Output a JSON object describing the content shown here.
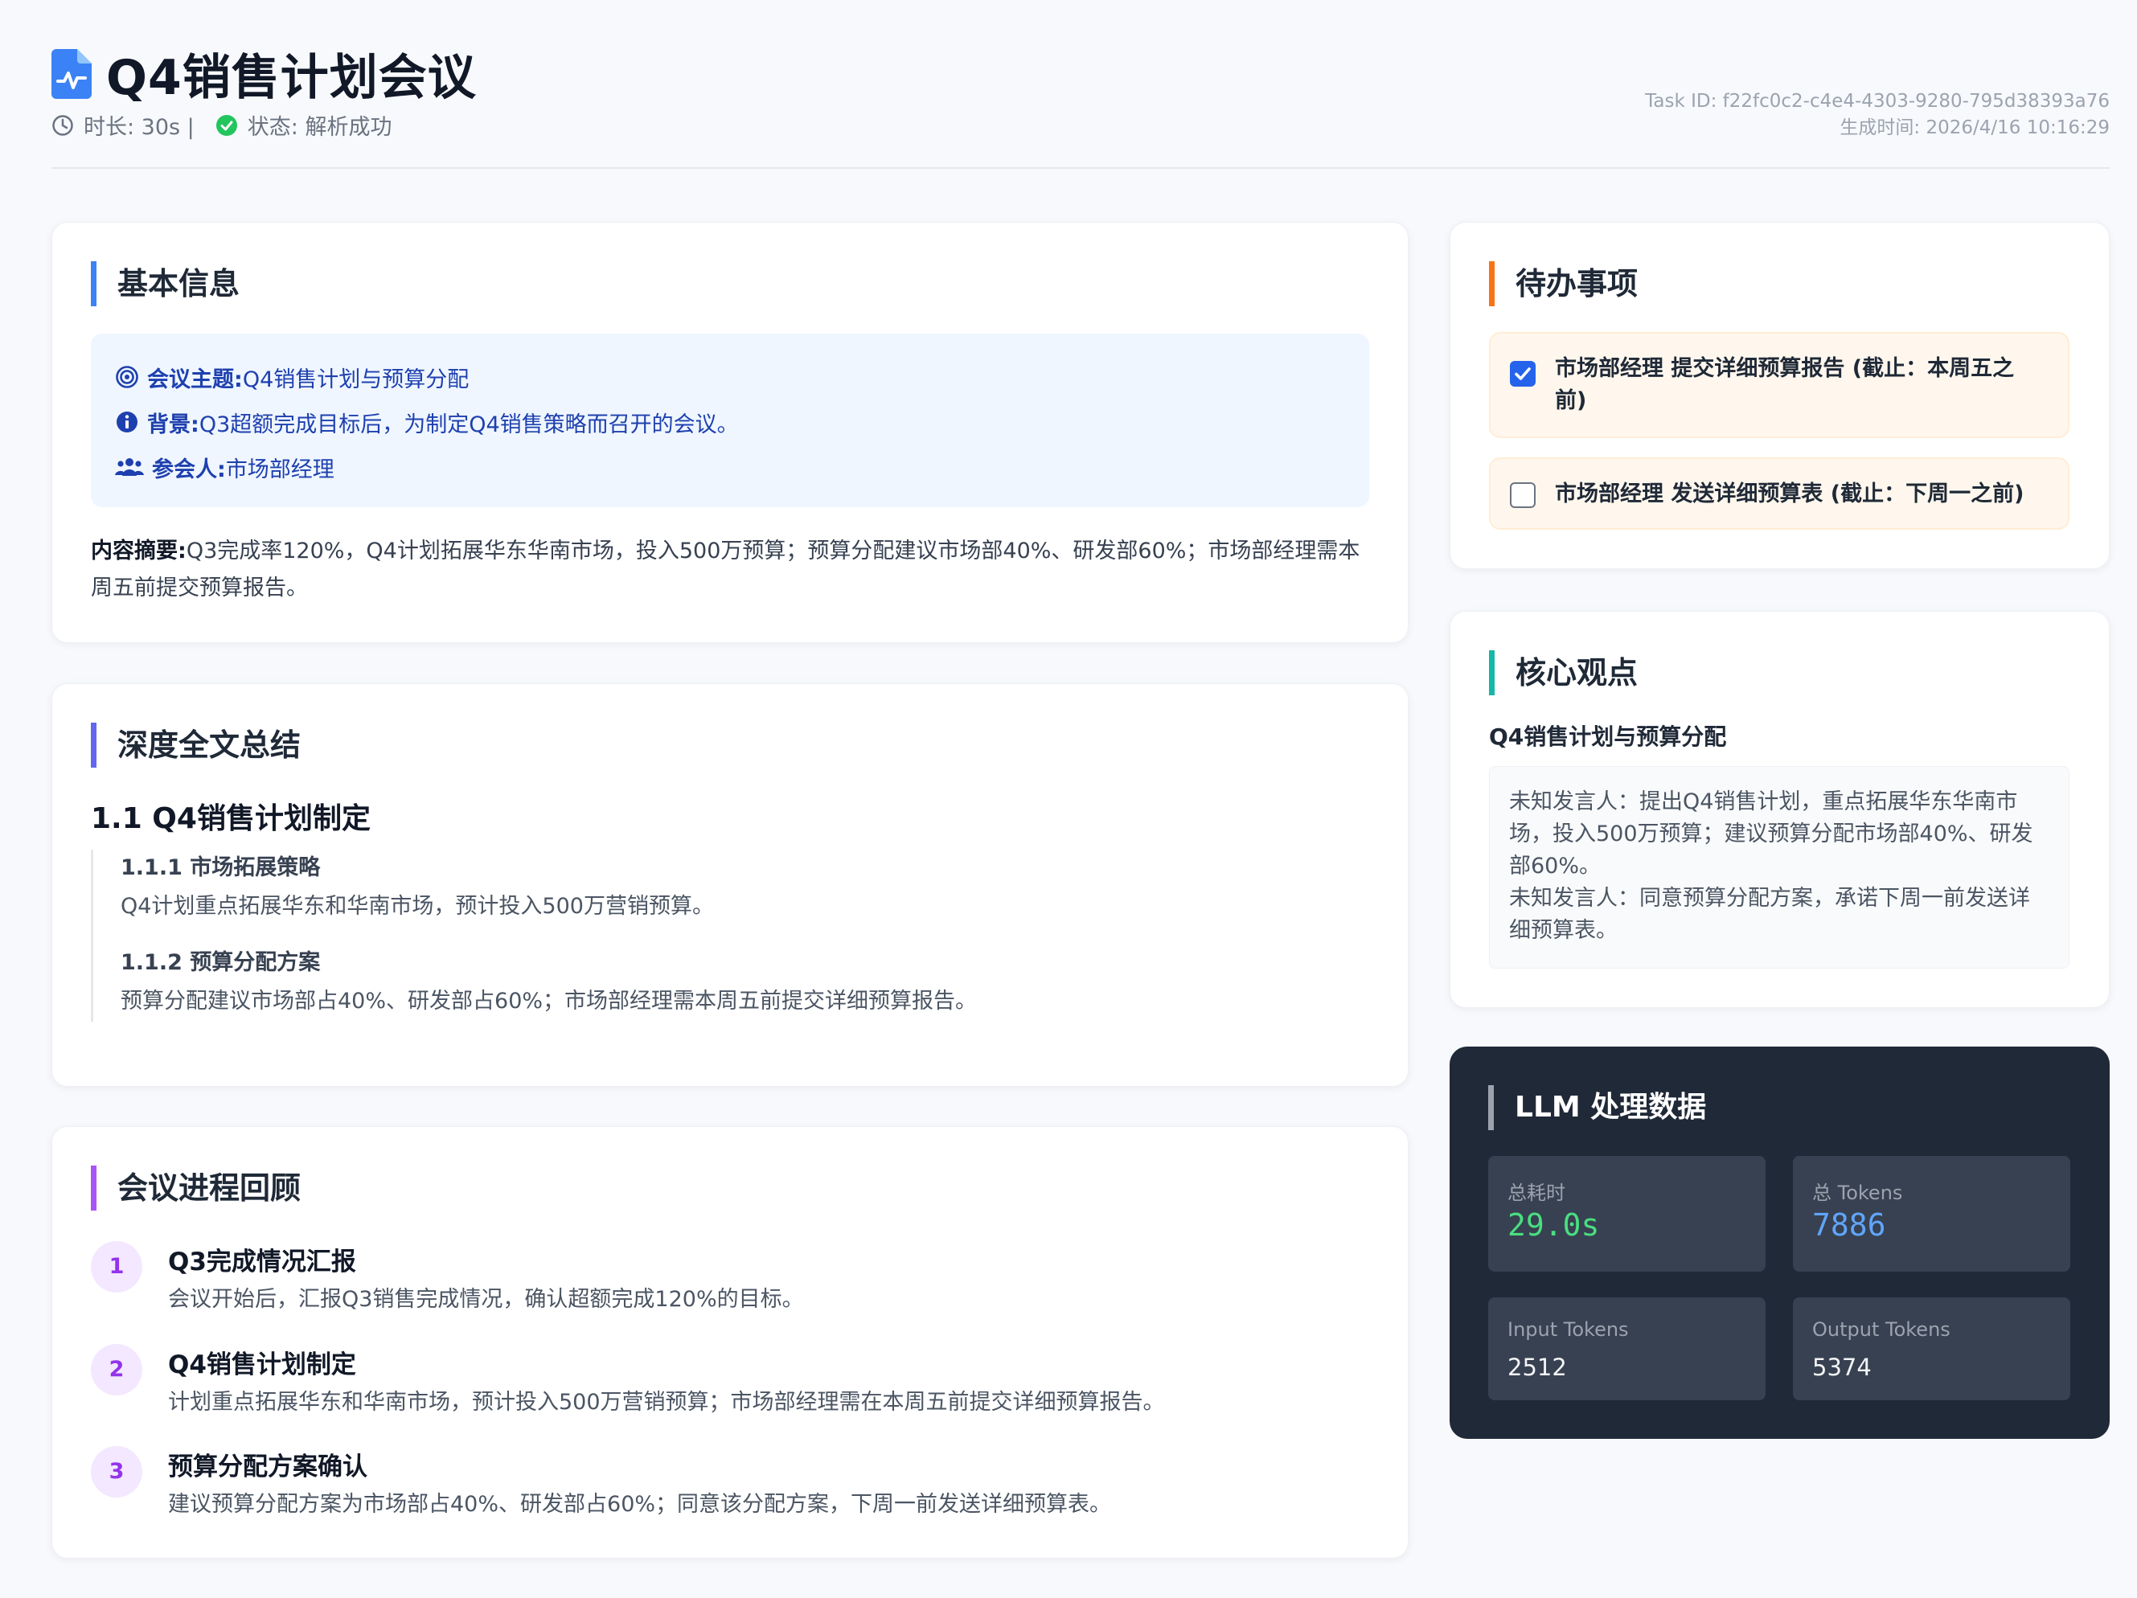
{
  "header": {
    "title": "Q4销售计划会议",
    "duration": "时长: 30s |",
    "status": "状态: 解析成功",
    "task_id": "Task ID: f22fc0c2-c4e4-4303-9280-795d38393a76",
    "generated": "生成时间: 2026/4/16 10:16:29"
  },
  "basic_info": {
    "title": "基本信息",
    "topic_label": "会议主题:",
    "topic_value": "Q4销售计划与预算分配",
    "background_label": "背景:",
    "background_value": "Q3超额完成目标后，为制定Q4销售策略而召开的会议。",
    "attendees_label": "参会人:",
    "attendees_value": "市场部经理",
    "summary_label": "内容摘要:",
    "summary_value": "Q3完成率120%，Q4计划拓展华东华南市场，投入500万预算；预算分配建议市场部40%、研发部60%；市场部经理需本周五前提交预算报告。"
  },
  "deep_summary": {
    "title": "深度全文总结",
    "section_title": "1.1 Q4销售计划制定",
    "items": [
      {
        "title": "1.1.1 市场拓展策略",
        "text": "Q4计划重点拓展华东和华南市场，预计投入500万营销预算。"
      },
      {
        "title": "1.1.2 预算分配方案",
        "text": "预算分配建议市场部占40%、研发部占60%；市场部经理需本周五前提交详细预算报告。"
      }
    ]
  },
  "progress": {
    "title": "会议进程回顾",
    "steps": [
      {
        "num": "1",
        "title": "Q3完成情况汇报",
        "text": "会议开始后，汇报Q3销售完成情况，确认超额完成120%的目标。"
      },
      {
        "num": "2",
        "title": "Q4销售计划制定",
        "text": "计划重点拓展华东和华南市场，预计投入500万营销预算；市场部经理需在本周五前提交详细预算报告。"
      },
      {
        "num": "3",
        "title": "预算分配方案确认",
        "text": "建议预算分配方案为市场部占40%、研发部占60%；同意该分配方案，下周一前发送详细预算表。"
      }
    ]
  },
  "todo": {
    "title": "待办事项",
    "items": [
      {
        "text": "市场部经理 提交详细预算报告 (截止：本周五之前)",
        "checked": true
      },
      {
        "text": "市场部经理 发送详细预算表 (截止：下周一之前)",
        "checked": false
      }
    ]
  },
  "key_points": {
    "title": "核心观点",
    "subtitle": "Q4销售计划与预算分配",
    "lines": [
      "未知发言人：提出Q4销售计划，重点拓展华东华南市场，投入500万预算；建议预算分配市场部40%、研发部60%。",
      "未知发言人：同意预算分配方案，承诺下周一前发送详细预算表。"
    ]
  },
  "llm": {
    "title": "LLM 处理数据",
    "total_time_label": "总耗时",
    "total_time_value": "29.0s",
    "total_tokens_label": "总 Tokens",
    "total_tokens_value": "7886",
    "input_tokens_label": "Input Tokens",
    "input_tokens_value": "2512",
    "output_tokens_label": "Output Tokens",
    "output_tokens_value": "5374"
  },
  "colors": {
    "accent_blue": "#3b82f6",
    "accent_indigo": "#6366f1",
    "accent_purple": "#a855f7",
    "accent_orange": "#f97316",
    "accent_teal": "#14b8a6",
    "time_green": "#4ade80",
    "tokens_blue": "#60a5fa",
    "dark_panel": "#1f2937"
  },
  "icons": [
    "doc-chart-icon",
    "clock-icon",
    "check-circle-icon",
    "target-icon",
    "info-icon",
    "users-icon",
    "checkbox-checked-icon",
    "checkbox-empty-icon"
  ]
}
